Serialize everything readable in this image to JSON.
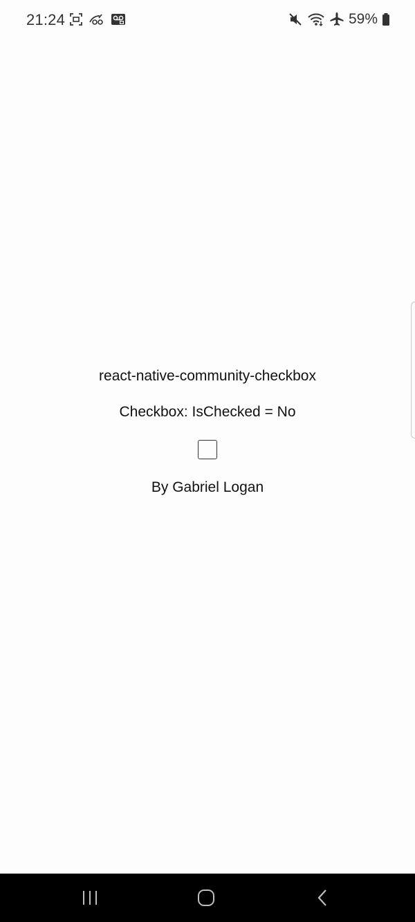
{
  "status_bar": {
    "time": "21:24",
    "left_icons": [
      "screenshot-icon",
      "tracking-icon",
      "voicemail-icon"
    ],
    "right_icons": [
      "mute-icon",
      "wifi-icon",
      "airplane-icon"
    ],
    "battery_percent": "59%"
  },
  "app": {
    "title": "react-native-community-checkbox",
    "state_label": "Checkbox: IsChecked = No",
    "checkbox_checked": false,
    "author": "By Gabriel Logan"
  },
  "nav_bar": {
    "buttons": [
      "recents-icon",
      "home-icon",
      "back-icon"
    ]
  },
  "colors": {
    "background": "#fefdfe",
    "text": "#111111",
    "nav_bar": "#000000"
  }
}
